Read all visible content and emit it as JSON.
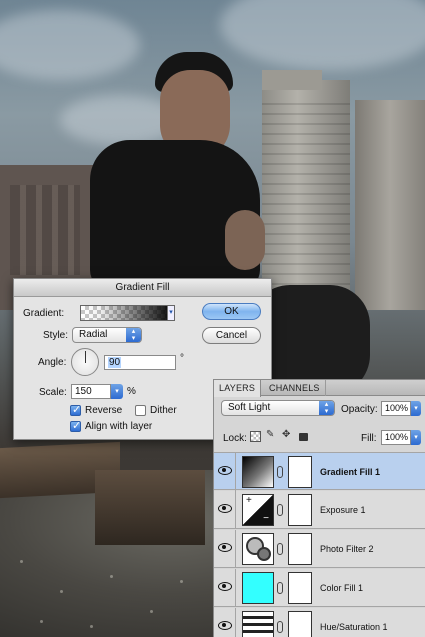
{
  "dialog": {
    "title": "Gradient Fill",
    "gradient_label": "Gradient:",
    "style_label": "Style:",
    "style_value": "Radial",
    "angle_label": "Angle:",
    "angle_value": "90",
    "angle_unit": "°",
    "scale_label": "Scale:",
    "scale_value": "150",
    "scale_unit": "%",
    "reverse_label": "Reverse",
    "reverse_checked": true,
    "dither_label": "Dither",
    "dither_checked": false,
    "align_label": "Align with layer",
    "align_checked": true,
    "ok_label": "OK",
    "cancel_label": "Cancel"
  },
  "layers_panel": {
    "tabs": [
      "LAYERS",
      "CHANNELS"
    ],
    "blend_mode": "Soft Light",
    "opacity_label": "Opacity:",
    "opacity_value": "100%",
    "lock_label": "Lock:",
    "fill_label": "Fill:",
    "fill_value": "100%",
    "layers": [
      {
        "name": "Gradient Fill 1",
        "selected": true,
        "thumb": "gradient-fill-icon"
      },
      {
        "name": "Exposure 1",
        "selected": false,
        "thumb": "exposure-icon"
      },
      {
        "name": "Photo Filter 2",
        "selected": false,
        "thumb": "photo-filter-icon"
      },
      {
        "name": "Color Fill 1",
        "selected": false,
        "thumb": "color-fill-swatch"
      },
      {
        "name": "Hue/Saturation 1",
        "selected": false,
        "thumb": "hue-saturation-icon"
      }
    ],
    "color_fill_color": "#33ffff",
    "selection_color": "#b9d0ee"
  }
}
